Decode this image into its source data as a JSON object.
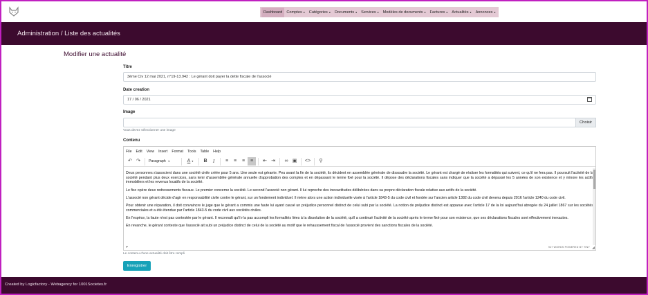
{
  "nav": {
    "items": [
      "Dashboard",
      "Comptes",
      "Catégories",
      "Documents",
      "Services",
      "Modèles de documents",
      "Factures",
      "Actualités",
      "Annonces"
    ]
  },
  "banner": {
    "title": "Administration / Liste des actualités"
  },
  "page": {
    "title": "Modifier une actualité"
  },
  "form": {
    "titre_label": "Titre",
    "titre_value": "3ème Civ 12 mai 2021, n°19-13.942 : Le gérant doit payer la dette fiscale de l'associé",
    "date_label": "Date creation",
    "date_value": "17 / 06 / 2021",
    "image_label": "Image",
    "image_hint": "Vous devez sélectionner une image",
    "choose_label": "Choisir",
    "contenu_label": "Contenu",
    "contenu_hint": "Le contenu d'une actualité doit être rempli",
    "submit_label": "Enregistrer"
  },
  "editor": {
    "menu": [
      "File",
      "Edit",
      "View",
      "Insert",
      "Format",
      "Tools",
      "Table",
      "Help"
    ],
    "block_format": "Paragraph",
    "paragraphs": [
      "Deux personnes s'associent dans une société civile créée pour 5 ans. Une seule est gérante. Peu avant la fin de la société, ils décident en assemblée générale de dissoudre la société. Le gérant est chargé de réaliser les formalités qui suivent, ce qu'il ne fera pas. Il poursuit l'activité de la société pendant plus deux exercices, sans tenir d'assemblée générale annuelle d'approbation des comptes et en dépassant le terme fixé pour la société. Il dépose des déclarations fiscales sans indiquer que la société a dépassé les 5 années de son existence et y minore les actifs immobiliers et les revenus locatifs de la société.",
      "Le fisc opère deux redressements fiscaux. Le premier concerne la société. Le second l'associé non gérant. Il lui reproche des inexactitudes délibérées dans sa propre déclaration fiscale relative aux actifs de la société.",
      "L'associé non gérant décide d'agir en responsabilité civile contre le gérant, sur un fondement individuel. Il mène alors une action individuelle visée à l'article 1843-5 du code civil et fondée sur l'ancien article 1382 du code civil devenu depuis 2016 l'article 1240 du code civil.",
      "Pour obtenir une réparation, il doit convaincre le juge que le gérant a commis une faute lui ayant causé un préjudice personnel distinct de celui subi par la société. La notion de préjudice distinct est apparue avec l'article 17 de la loi aujourd'hui abrogée du 24 juillet 1867 sur les sociétés commerciales et a été étendue par l'article 1843-5 du code civil aux sociétés civiles.",
      "En l'espèce, la faute n'est pas contestée par le gérant. Il reconnaît qu'il n'a pas accompli les formalités liées à la dissolution de la société, qu'il a continué l'activité de la société après le terme fixé pour son existence, que ses déclarations fiscales sont effectivement inexactes.",
      "En revanche, le gérant conteste que l'associé ait subi un préjudice distinct de celui de la société au motif que le rehaussement fiscal de l'associé provient des sanctions fiscales de la société."
    ],
    "status_path": "P",
    "status_words": "947 WORDS  POWERED BY TINY"
  },
  "footer": {
    "text": "Created by Logicfactory - Webagency for 1001Societes.fr"
  },
  "colors": {
    "primary": "#3c0a2e",
    "nav_bg": "#e4c9d4",
    "button": "#17a2b8",
    "frame": "#c020c0"
  }
}
